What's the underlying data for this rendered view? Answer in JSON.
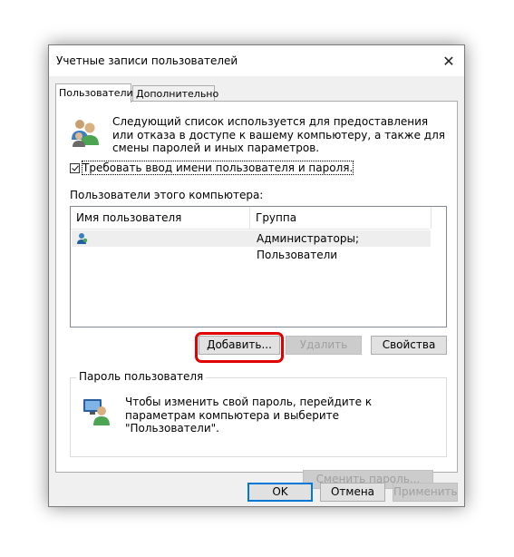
{
  "window": {
    "title": "Учетные записи пользователей",
    "close_glyph": "✕"
  },
  "tabs": [
    {
      "label": "Пользователи",
      "active": true
    },
    {
      "label": "Дополнительно",
      "active": false
    }
  ],
  "users_tab": {
    "description": "Следующий список используется для предоставления или отказа в доступе к вашему компьютеру, а также для смены паролей и иных параметров.",
    "require_login_checkbox": {
      "label": "Требовать ввод имени пользователя и пароля.",
      "checked": true
    },
    "users_list_label": "Пользователи этого компьютера:",
    "columns": [
      "Имя пользователя",
      "Группа"
    ],
    "rows": [
      {
        "name": "",
        "group": "Администраторы; Пользователи",
        "icon": "user-icon"
      }
    ],
    "buttons": {
      "add": "Добавить...",
      "remove": "Удалить",
      "properties": "Свойства"
    }
  },
  "password_group": {
    "title": "Пароль пользователя",
    "text": "Чтобы изменить свой пароль, перейдите к параметрам компьютера и выберите \"Пользователи\".",
    "change_button": "Сменить пароль..."
  },
  "footer": {
    "ok": "OK",
    "cancel": "Отмена",
    "apply": "Применить"
  },
  "colors": {
    "highlight": "#e00000",
    "accent": "#0078d7",
    "row_selected": "#eeeeee"
  }
}
